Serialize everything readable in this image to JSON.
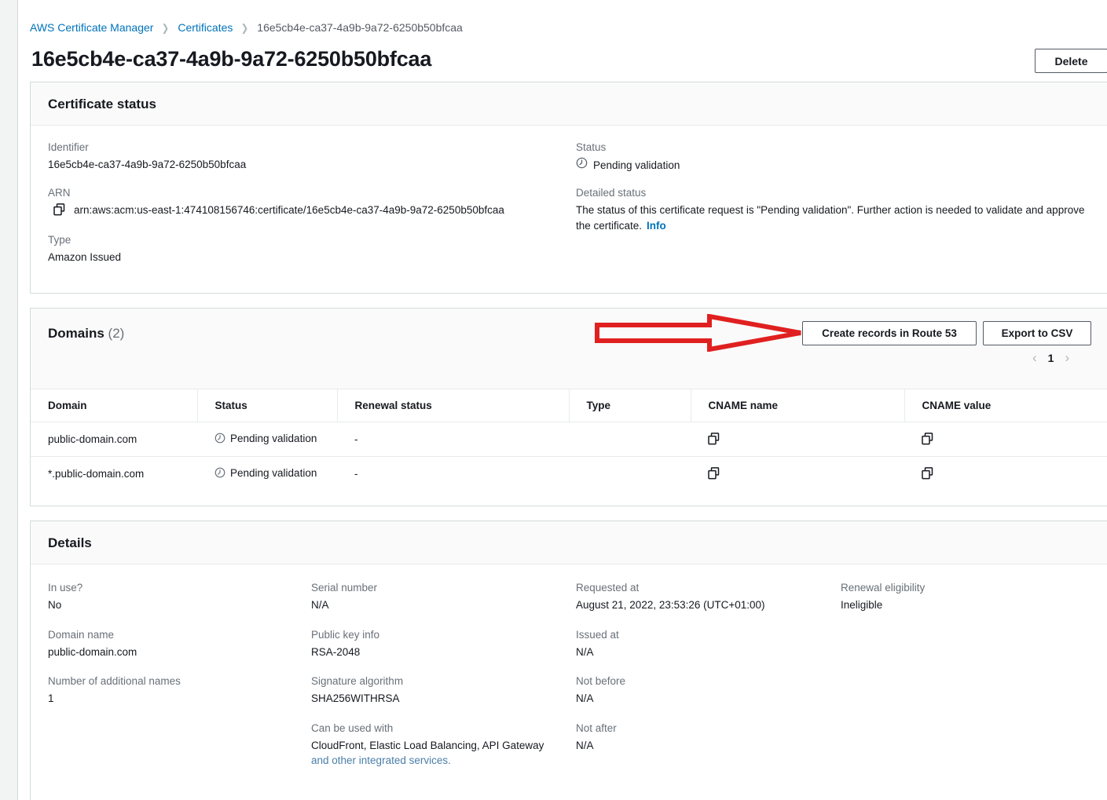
{
  "breadcrumb": {
    "service": "AWS Certificate Manager",
    "section": "Certificates",
    "current": "16e5cb4e-ca37-4a9b-9a72-6250b50bfcaa",
    "separator": "❯"
  },
  "header": {
    "title": "16e5cb4e-ca37-4a9b-9a72-6250b50bfcaa",
    "delete_label": "Delete"
  },
  "certificate_status": {
    "title": "Certificate status",
    "identifier_label": "Identifier",
    "identifier_value": "16e5cb4e-ca37-4a9b-9a72-6250b50bfcaa",
    "arn_label": "ARN",
    "arn_value": "arn:aws:acm:us-east-1:474108156746:certificate/16e5cb4e-ca37-4a9b-9a72-6250b50bfcaa",
    "type_label": "Type",
    "type_value": "Amazon Issued",
    "status_label": "Status",
    "status_value": "Pending validation",
    "detailed_status_label": "Detailed status",
    "detailed_status_value": "The status of this certificate request is \"Pending validation\". Further action is needed to validate and approve the certificate.",
    "info_link": "Info"
  },
  "domains": {
    "title": "Domains",
    "count": "(2)",
    "create_records_label": "Create records in Route 53",
    "export_csv_label": "Export to CSV",
    "pagination": {
      "prev": "‹",
      "page": "1",
      "next": "›"
    },
    "columns": [
      "Domain",
      "Status",
      "Renewal status",
      "Type",
      "CNAME name",
      "CNAME value"
    ],
    "rows": [
      {
        "domain": "public-domain.com",
        "status": "Pending validation",
        "renewal_status": "-",
        "type": "",
        "cname_name": "",
        "cname_value": ""
      },
      {
        "domain": "*.public-domain.com",
        "status": "Pending validation",
        "renewal_status": "-",
        "type": "",
        "cname_name": "",
        "cname_value": ""
      }
    ]
  },
  "details": {
    "title": "Details",
    "col1": [
      {
        "label": "In use?",
        "value": "No"
      },
      {
        "label": "Domain name",
        "value": "public-domain.com"
      },
      {
        "label": "Number of additional names",
        "value": "1"
      }
    ],
    "col2": [
      {
        "label": "Serial number",
        "value": "N/A"
      },
      {
        "label": "Public key info",
        "value": "RSA-2048"
      },
      {
        "label": "Signature algorithm",
        "value": "SHA256WITHRSA"
      },
      {
        "label": "Can be used with",
        "value": "CloudFront, Elastic Load Balancing, API Gateway",
        "link": "and other integrated services."
      }
    ],
    "col3": [
      {
        "label": "Requested at",
        "value": "August 21, 2022, 23:53:26 (UTC+01:00)"
      },
      {
        "label": "Issued at",
        "value": "N/A"
      },
      {
        "label": "Not before",
        "value": "N/A"
      },
      {
        "label": "Not after",
        "value": "N/A"
      }
    ],
    "col4": [
      {
        "label": "Renewal eligibility",
        "value": "Ineligible"
      }
    ]
  },
  "annotation": {
    "type": "arrow",
    "color": "#e02020",
    "points_to": "Create records in Route 53"
  },
  "colors": {
    "link": "#0073bb",
    "page_background": "#f2f3f3",
    "card_header": "#fafafa",
    "border": "#d5dbdb",
    "annotation_red": "#e02020"
  }
}
